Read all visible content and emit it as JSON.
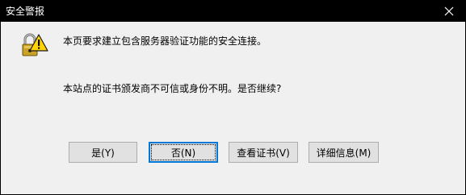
{
  "window": {
    "title": "安全警报"
  },
  "message": {
    "line1": "本页要求建立包含服务器验证功能的安全连接。",
    "line2": "本站点的证书颁发商不可信或身份不明。是否继续?"
  },
  "buttons": {
    "yes": "是(Y)",
    "no": "否(N)",
    "view_cert": "查看证书(V)",
    "more_info": "详细信息(M)"
  },
  "colors": {
    "titlebar": "#000000",
    "dialog_bg": "#f0f0f0",
    "button_bg": "#e1e1e1",
    "focus_border": "#0078d7",
    "warning_yellow": "#ffd400"
  },
  "icons": {
    "warning": "lock-warning-icon",
    "close": "close-icon"
  }
}
